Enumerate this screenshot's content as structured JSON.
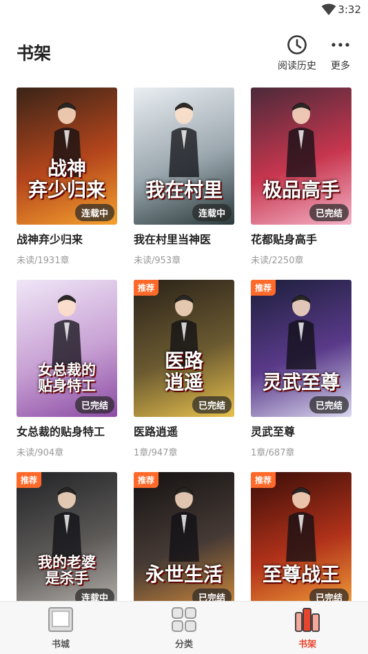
{
  "status": {
    "time": "3:32"
  },
  "header": {
    "title": "书架",
    "history_label": "阅读历史",
    "more_label": "更多"
  },
  "books": [
    {
      "name": "战神弃少归来",
      "progress": "未读/1931章",
      "state": "连载中",
      "tag": "",
      "cover_text": "战神\n弃少归来",
      "colors": [
        "#3a2418",
        "#b5461c",
        "#f4a12e"
      ]
    },
    {
      "name": "我在村里当神医",
      "progress": "未读/953章",
      "state": "连载中",
      "tag": "",
      "cover_text": "我在村里",
      "colors": [
        "#e9eef2",
        "#9aa6ad",
        "#2a3a3c"
      ]
    },
    {
      "name": "花都贴身高手",
      "progress": "未读/2250章",
      "state": "已完结",
      "tag": "",
      "cover_text": "极品高手",
      "colors": [
        "#4b2a3a",
        "#c7364e",
        "#f3b1c6"
      ]
    },
    {
      "name": "女总裁的贴身特工",
      "progress": "未读/904章",
      "state": "已完结",
      "tag": "",
      "cover_text": "女总裁的\n贴身特工",
      "colors": [
        "#f0e6f7",
        "#c7a0d3",
        "#8b4ba3"
      ]
    },
    {
      "name": "医路逍遥",
      "progress": "1章/947章",
      "state": "已完结",
      "tag": "推荐",
      "cover_text": "医路\n逍遥",
      "colors": [
        "#2a2219",
        "#6b5a31",
        "#e7c14c"
      ]
    },
    {
      "name": "灵武至尊",
      "progress": "1章/687章",
      "state": "已完结",
      "tag": "推荐",
      "cover_text": "灵武至尊",
      "colors": [
        "#1c1f3b",
        "#5a3a8a",
        "#d9d6ee"
      ]
    },
    {
      "name": "",
      "progress": "",
      "state": "连载中",
      "tag": "推荐",
      "cover_text": "我的老婆\n是杀手",
      "colors": [
        "#222326",
        "#5d5a58",
        "#b7b2ad"
      ]
    },
    {
      "name": "",
      "progress": "",
      "state": "已完结",
      "tag": "推荐",
      "cover_text": "永世生活",
      "colors": [
        "#141212",
        "#463a35",
        "#d08a3c"
      ]
    },
    {
      "name": "",
      "progress": "",
      "state": "已完结",
      "tag": "推荐",
      "cover_text": "至尊战王",
      "colors": [
        "#3a0d08",
        "#b1321a",
        "#f3a03a"
      ]
    }
  ],
  "nav": [
    {
      "label": "书城",
      "icon": "bookstore-icon",
      "active": false
    },
    {
      "label": "分类",
      "icon": "category-icon",
      "active": false
    },
    {
      "label": "书架",
      "icon": "bookshelf-icon",
      "active": true
    }
  ],
  "accent": "#e8452e",
  "tag_color": "#ff6a2a"
}
